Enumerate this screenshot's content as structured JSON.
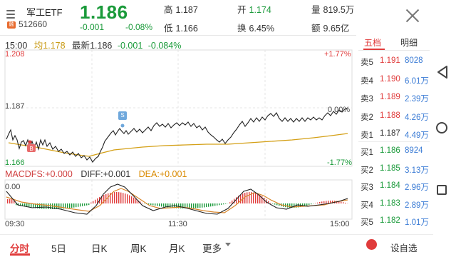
{
  "header": {
    "name": "军工ETF",
    "code": "512660",
    "badge": "融",
    "price": "1.186",
    "change": "-0.001",
    "change_pct": "-0.08%",
    "high_label": "高",
    "high": "1.187",
    "low_label": "低",
    "low": "1.166",
    "open_label": "开",
    "open": "1.174",
    "turnover_label": "换",
    "turnover": "6.45%",
    "volume_label": "量",
    "volume": "819.5万",
    "amount_label": "额",
    "amount": "9.65亿"
  },
  "chart_info": {
    "time": "15:00",
    "avg_label": "均",
    "avg": "1.178",
    "latest_label": "最新",
    "latest": "1.186",
    "change": "-0.001",
    "change_pct": "-0.084%"
  },
  "axis": {
    "y_top": "1.208",
    "y_mid": "1.187",
    "y_bottom": "1.166",
    "pct_top": "+1.77%",
    "pct_mid": "0.00%",
    "pct_bottom": "-1.77%",
    "macd_zero": "0.00",
    "t_start": "09:30",
    "t_mid": "11:30",
    "t_end": "15:00"
  },
  "markers": {
    "b": "B",
    "s": "S"
  },
  "macd": {
    "macd_label": "MACDFS:+0.000",
    "diff_label": "DIFF:+0.001",
    "dea_label": "DEA:+0.001"
  },
  "orderbook": {
    "tab_active": "五档",
    "tab_inactive": "明细",
    "asks": [
      {
        "label": "卖5",
        "price": "1.191",
        "vol": "8028",
        "color": "red"
      },
      {
        "label": "卖4",
        "price": "1.190",
        "vol": "6.01万",
        "color": "red"
      },
      {
        "label": "卖3",
        "price": "1.189",
        "vol": "2.39万",
        "color": "red"
      },
      {
        "label": "卖2",
        "price": "1.188",
        "vol": "4.26万",
        "color": "red"
      },
      {
        "label": "卖1",
        "price": "1.187",
        "vol": "4.49万",
        "color": "dark"
      }
    ],
    "bids": [
      {
        "label": "买1",
        "price": "1.186",
        "vol": "8924",
        "color": "green"
      },
      {
        "label": "买2",
        "price": "1.185",
        "vol": "3.13万",
        "color": "green"
      },
      {
        "label": "买3",
        "price": "1.184",
        "vol": "2.96万",
        "color": "green"
      },
      {
        "label": "买4",
        "price": "1.183",
        "vol": "2.89万",
        "color": "green"
      },
      {
        "label": "买5",
        "price": "1.182",
        "vol": "1.01万",
        "color": "green"
      }
    ]
  },
  "bottom_tabs": {
    "intraday": "分时",
    "five_day": "5日",
    "day_k": "日K",
    "week_k": "周K",
    "month_k": "月K",
    "more": "更多",
    "preference": "设自选"
  },
  "colors": {
    "up": "#e03b3b",
    "down": "#1a9a3a",
    "avg_line": "#d4a017",
    "price_line": "#222222",
    "diff_line": "#222222",
    "dea_line": "#d9862b"
  }
}
